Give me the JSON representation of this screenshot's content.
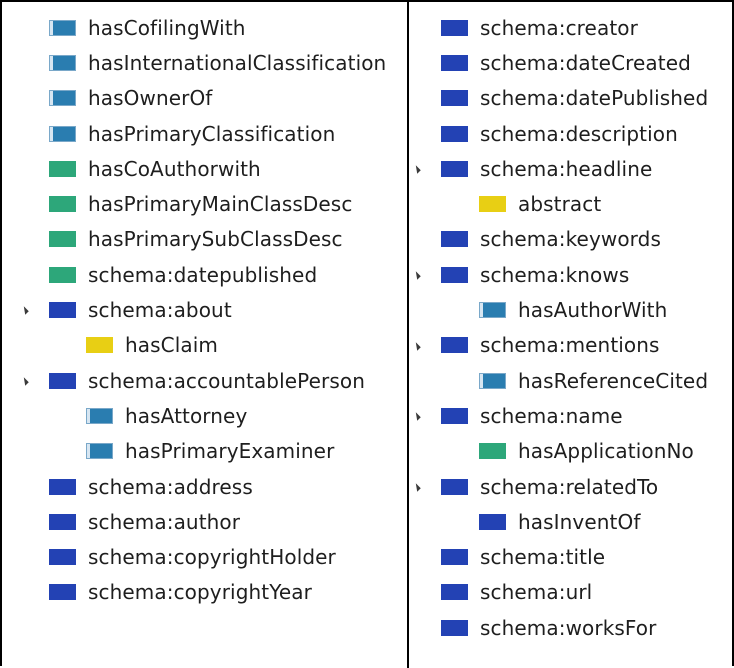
{
  "colors": {
    "steel": "#2a7db0",
    "navy": "#2342b4",
    "green": "#2da77a",
    "yellow": "#e8cf14"
  },
  "left_column": [
    {
      "label": "hasCofilingWith",
      "color": "steel",
      "level": 0,
      "expanded": false
    },
    {
      "label": "hasInternationalClassification",
      "color": "steel",
      "level": 0,
      "expanded": false
    },
    {
      "label": "hasOwnerOf",
      "color": "steel",
      "level": 0,
      "expanded": false
    },
    {
      "label": "hasPrimaryClassification",
      "color": "steel",
      "level": 0,
      "expanded": false
    },
    {
      "label": "hasCoAuthorwith",
      "color": "green",
      "level": 0,
      "expanded": false
    },
    {
      "label": "hasPrimaryMainClassDesc",
      "color": "green",
      "level": 0,
      "expanded": false
    },
    {
      "label": "hasPrimarySubClassDesc",
      "color": "green",
      "level": 0,
      "expanded": false
    },
    {
      "label": "schema:datepublished",
      "color": "green",
      "level": 0,
      "expanded": false
    },
    {
      "label": "schema:about",
      "color": "navy",
      "level": 0,
      "expanded": true
    },
    {
      "label": "hasClaim",
      "color": "yellow",
      "level": 1,
      "expanded": false
    },
    {
      "label": "schema:accountablePerson",
      "color": "navy",
      "level": 0,
      "expanded": true
    },
    {
      "label": "hasAttorney",
      "color": "steel",
      "level": 1,
      "expanded": false
    },
    {
      "label": "hasPrimaryExaminer",
      "color": "steel",
      "level": 1,
      "expanded": false
    },
    {
      "label": "schema:address",
      "color": "navy",
      "level": 0,
      "expanded": false
    },
    {
      "label": "schema:author",
      "color": "navy",
      "level": 0,
      "expanded": false
    },
    {
      "label": "schema:copyrightHolder",
      "color": "navy",
      "level": 0,
      "expanded": false
    },
    {
      "label": "schema:copyrightYear",
      "color": "navy",
      "level": 0,
      "expanded": false
    }
  ],
  "right_column": [
    {
      "label": "schema:creator",
      "color": "navy",
      "level": 0,
      "expanded": false
    },
    {
      "label": "schema:dateCreated",
      "color": "navy",
      "level": 0,
      "expanded": false
    },
    {
      "label": "schema:datePublished",
      "color": "navy",
      "level": 0,
      "expanded": false
    },
    {
      "label": "schema:description",
      "color": "navy",
      "level": 0,
      "expanded": false
    },
    {
      "label": "schema:headline",
      "color": "navy",
      "level": 0,
      "expanded": true
    },
    {
      "label": "abstract",
      "color": "yellow",
      "level": 1,
      "expanded": false
    },
    {
      "label": "schema:keywords",
      "color": "navy",
      "level": 0,
      "expanded": false
    },
    {
      "label": "schema:knows",
      "color": "navy",
      "level": 0,
      "expanded": true
    },
    {
      "label": "hasAuthorWith",
      "color": "steel",
      "level": 1,
      "expanded": false
    },
    {
      "label": "schema:mentions",
      "color": "navy",
      "level": 0,
      "expanded": true
    },
    {
      "label": "hasReferenceCited",
      "color": "steel",
      "level": 1,
      "expanded": false
    },
    {
      "label": "schema:name",
      "color": "navy",
      "level": 0,
      "expanded": true
    },
    {
      "label": "hasApplicationNo",
      "color": "green",
      "level": 1,
      "expanded": false
    },
    {
      "label": "schema:relatedTo",
      "color": "navy",
      "level": 0,
      "expanded": true
    },
    {
      "label": "hasInventOf",
      "color": "navy",
      "level": 1,
      "expanded": false
    },
    {
      "label": "schema:title",
      "color": "navy",
      "level": 0,
      "expanded": false
    },
    {
      "label": "schema:url",
      "color": "navy",
      "level": 0,
      "expanded": false
    },
    {
      "label": "schema:worksFor",
      "color": "navy",
      "level": 0,
      "expanded": false
    }
  ]
}
